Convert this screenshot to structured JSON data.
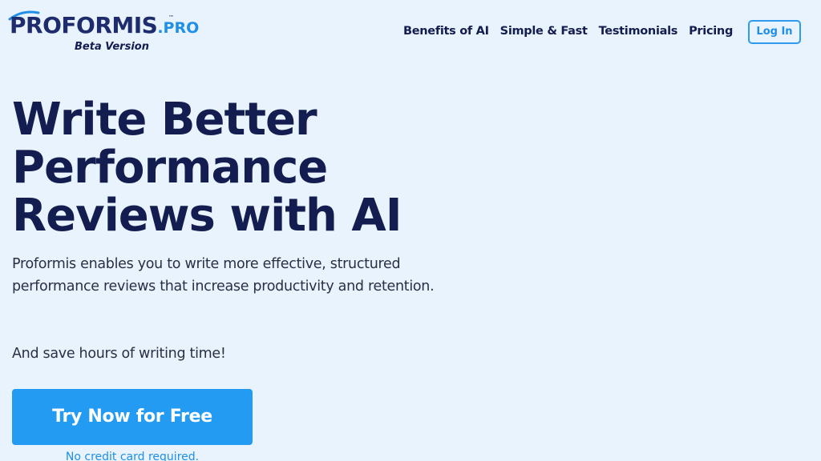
{
  "brand": {
    "name_main": "PROFORMIS",
    "name_suffix": ".PRO",
    "trademark": "™",
    "tagline": "Beta Version"
  },
  "nav": {
    "items": [
      {
        "label": "Benefits of AI"
      },
      {
        "label": "Simple & Fast"
      },
      {
        "label": "Testimonials"
      },
      {
        "label": "Pricing"
      }
    ],
    "login_label": "Log In"
  },
  "hero": {
    "title_lines": [
      "Write Better",
      "Performance",
      "Reviews with AI"
    ],
    "description": "Proformis enables you to write more effective, structured performance reviews that increase productivity and retention.",
    "secondary": "And save hours of writing time!",
    "cta_label": "Try Now for Free",
    "cta_note": "No credit card required."
  },
  "colors": {
    "background": "#e9f3fd",
    "navy": "#141d4f",
    "accent": "#249bf3"
  }
}
